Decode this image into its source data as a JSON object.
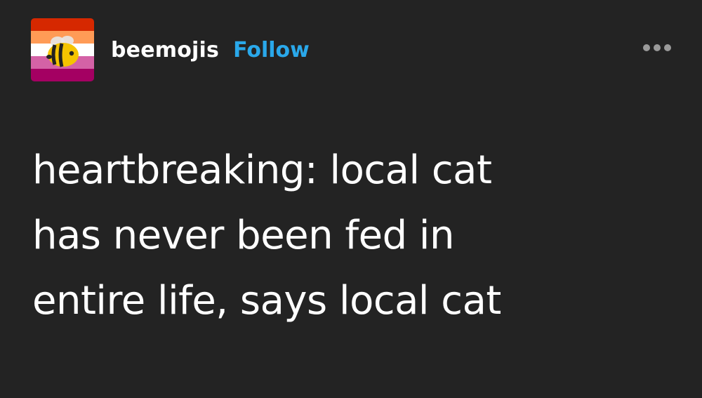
{
  "post": {
    "author": {
      "username": "beemojis",
      "avatar_icon": "bee-avatar-icon",
      "avatar_flag_colors": [
        "#d62800",
        "#ff9b56",
        "#ffffff",
        "#d462a6",
        "#a40062"
      ]
    },
    "follow_label": "Follow",
    "menu_icon": "more-options-icon",
    "body_lines": [
      "heartbreaking: local cat",
      "has never been fed in",
      "entire life, says local cat"
    ]
  },
  "colors": {
    "background": "#232323",
    "text": "#ffffff",
    "accent": "#2aa8ea",
    "muted": "#9a9a9a"
  }
}
